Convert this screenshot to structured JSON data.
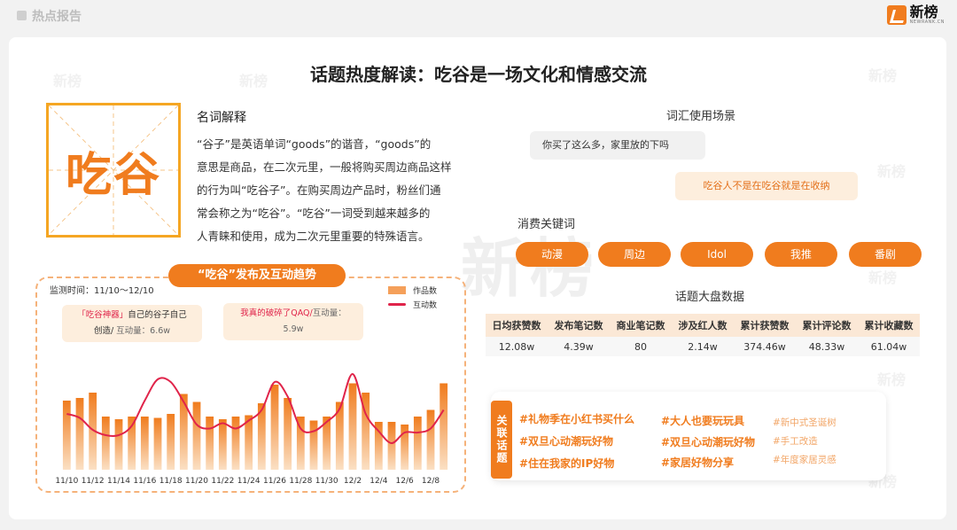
{
  "header": {
    "title": "热点报告"
  },
  "brand": {
    "name": "新榜",
    "sub": "NEWRANK.CN",
    "accent": "#f07c1e"
  },
  "watermark": "新榜",
  "main_title": "话题热度解读：吃谷是一场文化和情感交流",
  "hero_word": "吃谷",
  "definition": {
    "title": "名词解释",
    "lines": [
      "“谷子”是英语单词“goods”的谐音，“goods”的",
      "意思是商品，在二次元里，一般将购买周边商品这样",
      "的行为叫“吃谷子”。在购买周边产品时，粉丝们通",
      "常会称之为“吃谷”。“吃谷”一词受到越来越多的",
      "人青睐和使用，成为二次元里重要的特殊语言。"
    ]
  },
  "scene": {
    "title": "词汇使用场景",
    "bubble_left": "你买了这么多，家里放的下吗",
    "bubble_right": "吃谷人不是在吃谷就是在收纳"
  },
  "keywords": {
    "title": "消费关键词",
    "items": [
      "动漫",
      "周边",
      "Idol",
      "我推",
      "番剧"
    ]
  },
  "stats": {
    "title": "话题大盘数据",
    "headers": [
      "日均获赞数",
      "发布笔记数",
      "商业笔记数",
      "涉及红人数",
      "累计获赞数",
      "累计评论数",
      "累计收藏数"
    ],
    "values": [
      "12.08w",
      "4.39w",
      "80",
      "2.14w",
      "374.46w",
      "48.33w",
      "61.04w"
    ]
  },
  "chart": {
    "title": "“吃谷”发布及互动趋势",
    "monitor": "监测时间：11/10～12/10",
    "legend_bar": "作品数",
    "legend_line": "互动数",
    "note1_hl": "「吃谷神器」",
    "note1_a": "自己的谷子自己",
    "note1_b": "创造/",
    "note1_c": "互动量：6.6w",
    "note2_a": "我真的破碎了QAQ/",
    "note2_b": "互动量：",
    "note2_c": "5.9w"
  },
  "chart_data": {
    "type": "bar",
    "x_tick_labels": [
      "11/10",
      "11/12",
      "11/14",
      "11/16",
      "11/18",
      "11/20",
      "11/22",
      "11/24",
      "11/26",
      "11/28",
      "11/30",
      "12/2",
      "12/4",
      "12/6",
      "12/8"
    ],
    "series": [
      {
        "name": "作品数",
        "type": "bar",
        "values": [
          52,
          54,
          58,
          40,
          38,
          40,
          40,
          39,
          42,
          57,
          51,
          40,
          38,
          40,
          41,
          50,
          64,
          54,
          40,
          37,
          40,
          51,
          65,
          58,
          36,
          36,
          34,
          40,
          45,
          65
        ]
      },
      {
        "name": "互动数",
        "type": "line",
        "values": [
          42,
          39,
          30,
          26,
          26,
          33,
          52,
          68,
          66,
          51,
          34,
          31,
          35,
          31,
          37,
          45,
          66,
          55,
          31,
          29,
          36,
          46,
          72,
          42,
          29,
          20,
          28,
          28,
          31,
          45
        ]
      }
    ],
    "ylim": [
      0,
      100
    ],
    "grid": false,
    "legend": "top-right"
  },
  "related": {
    "label": "关联话题",
    "col1": [
      "#礼物季在小红书买什么",
      "#双旦心动潮玩好物",
      "#住在我家的IP好物"
    ],
    "col2": [
      "#大人也要玩玩具",
      "#双旦心动潮玩好物",
      "#家居好物分享"
    ],
    "col3": [
      "#新中式圣诞树",
      "#手工改造",
      "#年度家居灵感"
    ]
  }
}
